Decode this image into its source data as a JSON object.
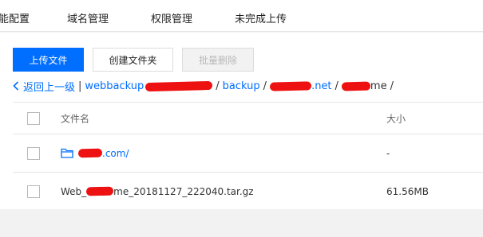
{
  "tabs": [
    "能配置",
    "域名管理",
    "权限管理",
    "未完成上传"
  ],
  "toolbar": {
    "upload_label": "上传文件",
    "create_folder_label": "创建文件夹",
    "batch_delete_label": "批量删除"
  },
  "breadcrumb": {
    "back_label": "返回上一级",
    "divider": "|",
    "segments": [
      "webbackup",
      "/",
      "backup",
      "/",
      ".net",
      "/",
      "me",
      "/"
    ]
  },
  "table": {
    "columns": {
      "name": "文件名",
      "size": "大小"
    },
    "rows": [
      {
        "name_suffix": ".com/",
        "size": "-",
        "type": "folder"
      },
      {
        "name_prefix": "Web_",
        "name_suffix": "me_20181127_222040.tar.gz",
        "size": "61.56MB",
        "type": "file"
      }
    ]
  },
  "colors": {
    "primary": "#006eff",
    "redaction": "#ee1111",
    "background": "#f2f2f2"
  }
}
